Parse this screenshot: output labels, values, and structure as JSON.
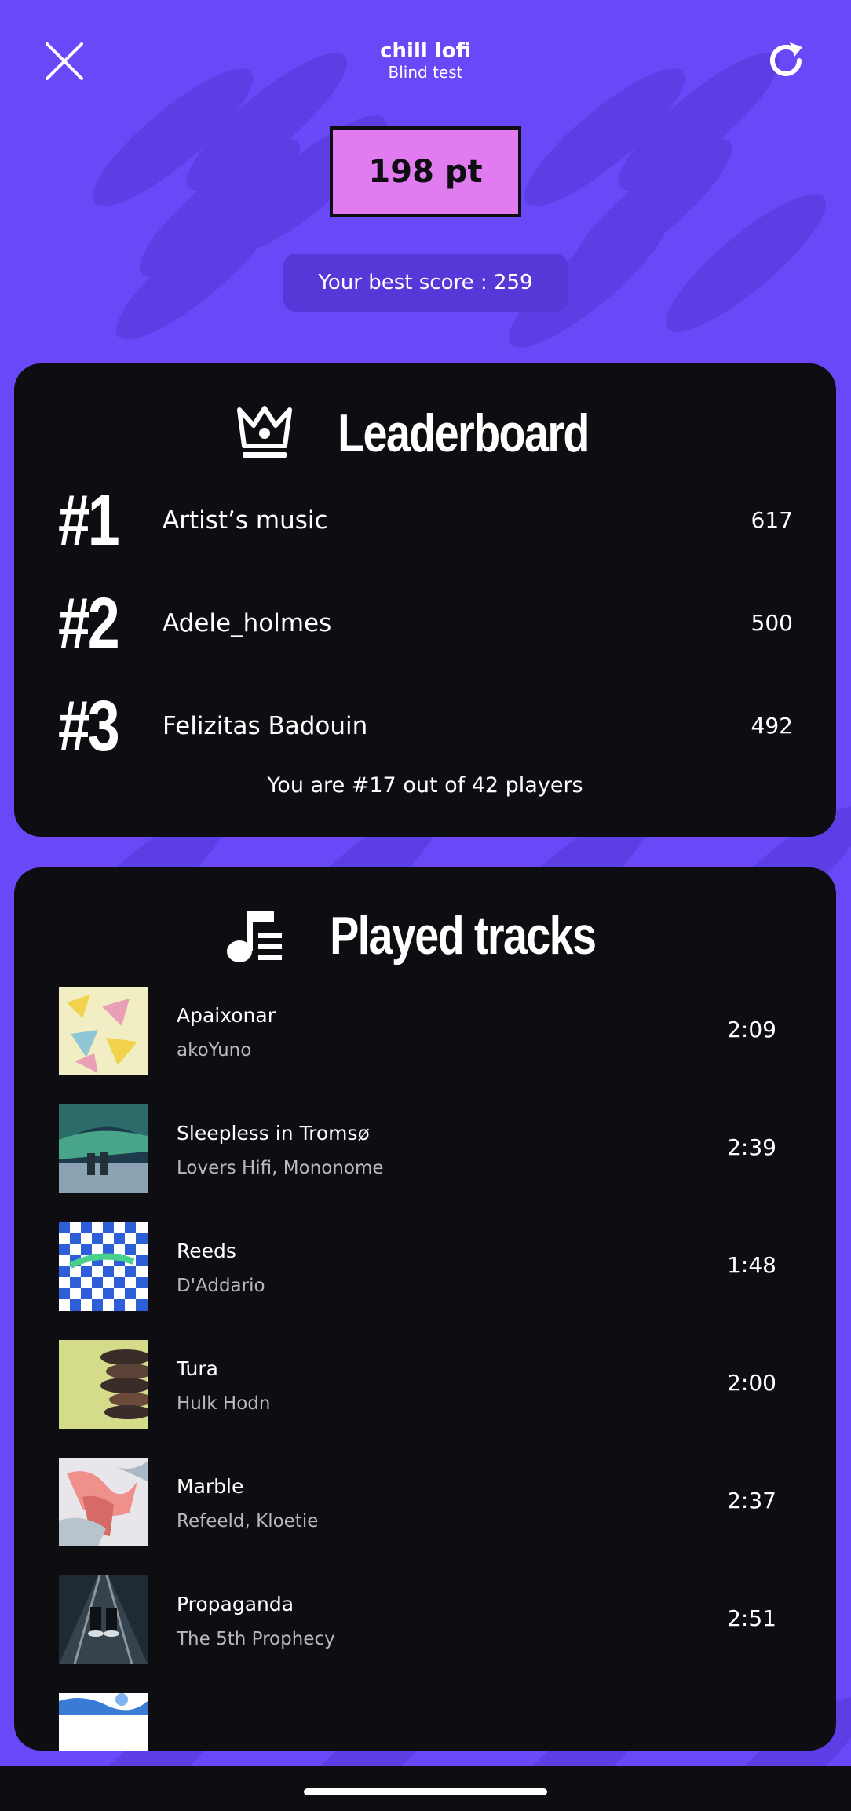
{
  "header": {
    "title": "chill lofi",
    "subtitle": "Blind test",
    "close_icon": "close-icon",
    "refresh_icon": "refresh-icon"
  },
  "score": {
    "points": "198 pt",
    "best": "Your best score : 259"
  },
  "leaderboard": {
    "heading": "Leaderboard",
    "icon": "crown-icon",
    "entries": [
      {
        "rank": "#1",
        "name": "Artist’s music",
        "score": "617"
      },
      {
        "rank": "#2",
        "name": "Adele_holmes",
        "score": "500"
      },
      {
        "rank": "#3",
        "name": "Felizitas Badouin",
        "score": "492"
      }
    ],
    "footer": "You are #17 out of 42 players"
  },
  "tracks": {
    "heading": "Played tracks",
    "icon": "music-list-icon",
    "items": [
      {
        "title": "Apaixonar",
        "artist": "akoYuno",
        "duration": "2:09"
      },
      {
        "title": "Sleepless in Tromsø",
        "artist": "Lovers Hifi, Mononome",
        "duration": "2:39"
      },
      {
        "title": "Reeds",
        "artist": "D'Addario",
        "duration": "1:48"
      },
      {
        "title": "Tura",
        "artist": "Hulk Hodn",
        "duration": "2:00"
      },
      {
        "title": "Marble",
        "artist": "Refeeld, Kloetie",
        "duration": "2:37"
      },
      {
        "title": "Propaganda",
        "artist": "The 5th Prophecy",
        "duration": "2:51"
      }
    ]
  },
  "colors": {
    "background": "#6a48f7",
    "card": "#0e0d12",
    "score_box": "#e07bf0",
    "best_score_pill": "#5637d8"
  }
}
